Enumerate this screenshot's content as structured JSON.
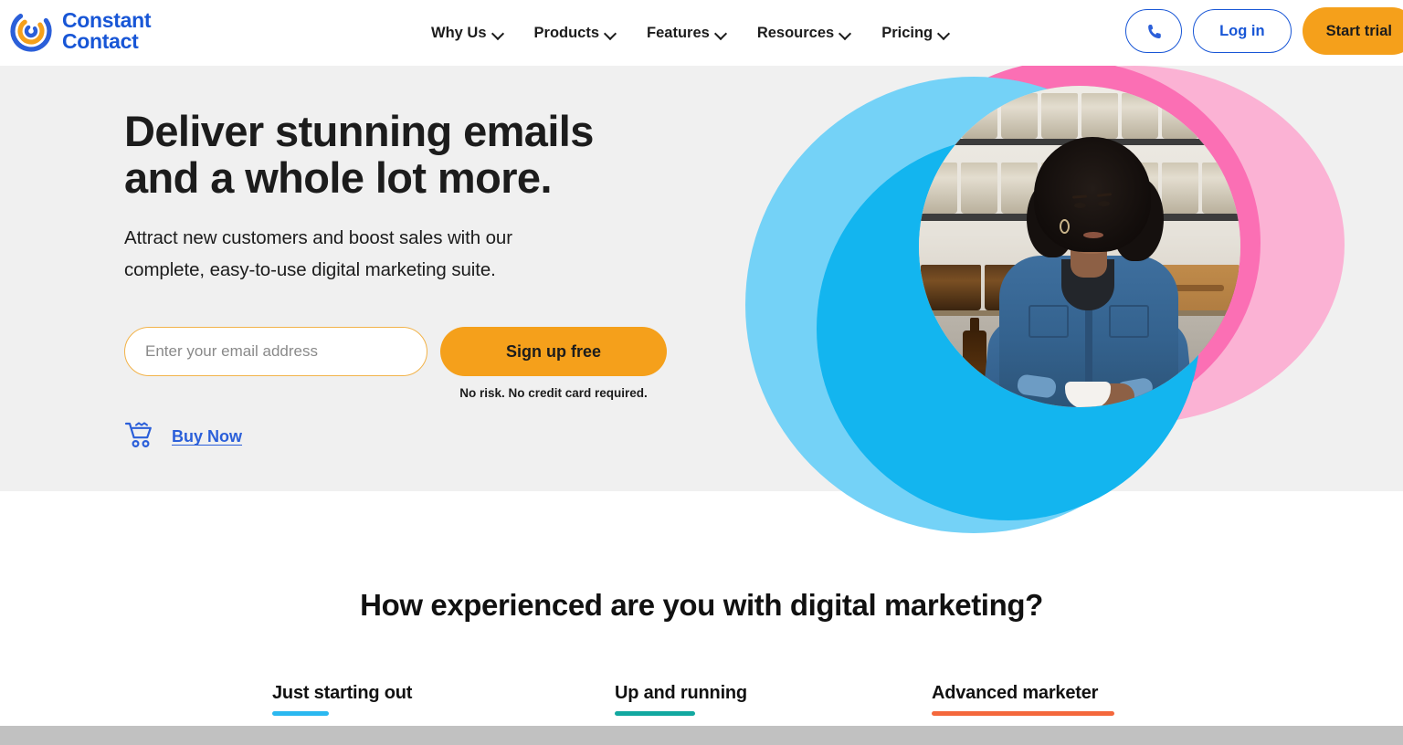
{
  "header": {
    "logo": {
      "line1": "Constant",
      "line2": "Contact",
      "icon": "constant-contact-logo-icon"
    },
    "nav": [
      {
        "label": "Why Us"
      },
      {
        "label": "Products"
      },
      {
        "label": "Features"
      },
      {
        "label": "Resources"
      },
      {
        "label": "Pricing"
      }
    ],
    "phone_icon": "phone-icon",
    "login_label": "Log in",
    "trial_label": "Start trial"
  },
  "hero": {
    "heading_line1": "Deliver stunning emails",
    "heading_line2": "and a whole lot more.",
    "sub_line1": "Attract new customers and boost sales with our",
    "sub_line2": "complete, easy-to-use digital marketing suite.",
    "email_placeholder": "Enter your email address",
    "email_value": "",
    "signup_label": "Sign up free",
    "fineprint": "No risk. No credit card required.",
    "buy_now_label": "Buy Now",
    "cart_icon": "shopping-cart-icon",
    "image_alt": "Woman in denim shirt at a shop counter"
  },
  "experience": {
    "title": "How experienced are you with digital marketing?",
    "tabs": [
      {
        "label": "Just starting out",
        "color": "#2bb8f0"
      },
      {
        "label": "Up and running",
        "color": "#12a8a0"
      },
      {
        "label": "Advanced marketer",
        "color": "#f4683c"
      }
    ]
  },
  "colors": {
    "brand_blue": "#1856d6",
    "accent_orange": "#f5a01b",
    "hero_background": "#f0f0f0",
    "circle_pink_pale": "#fbb2d4",
    "circle_pink_hot": "#fb6fb4",
    "circle_blue_pale": "#74d2f7",
    "circle_blue_vivid": "#13b5ef"
  }
}
